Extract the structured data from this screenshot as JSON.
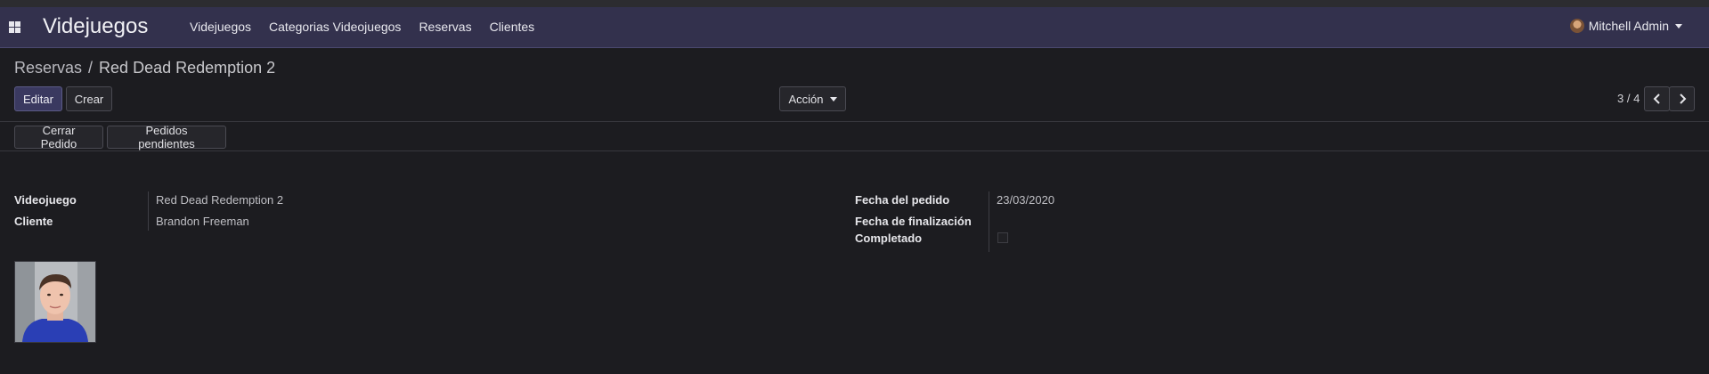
{
  "app": {
    "title": "Videjuegos"
  },
  "nav": {
    "items": [
      "Videjuegos",
      "Categorias Videojuegos",
      "Reservas",
      "Clientes"
    ],
    "user": "Mitchell Admin"
  },
  "breadcrumb": {
    "parent": "Reservas",
    "separator": "/",
    "current": "Red Dead Redemption 2"
  },
  "toolbar": {
    "edit": "Editar",
    "create": "Crear",
    "action": "Acción",
    "pager": "3 / 4"
  },
  "status_buttons": {
    "close_order": "Cerrar Pedido",
    "pending_orders": "Pedidos pendientes"
  },
  "form": {
    "videojuego_label": "Videojuego",
    "videojuego_value": "Red Dead Redemption 2",
    "cliente_label": "Cliente",
    "cliente_value": "Brandon Freeman",
    "fecha_pedido_label": "Fecha del pedido",
    "fecha_pedido_value": "23/03/2020",
    "fecha_fin_label": "Fecha de finalización",
    "fecha_fin_value": "",
    "completado_label": "Completado",
    "completado_value": false
  },
  "colors": {
    "navbar": "#33314d",
    "background": "#1c1c20",
    "primary_button": "#3a3960"
  },
  "icons": {
    "apps": "apps-grid-icon",
    "prev": "chevron-left-icon",
    "next": "chevron-right-icon",
    "dropdown": "caret-down-icon"
  }
}
